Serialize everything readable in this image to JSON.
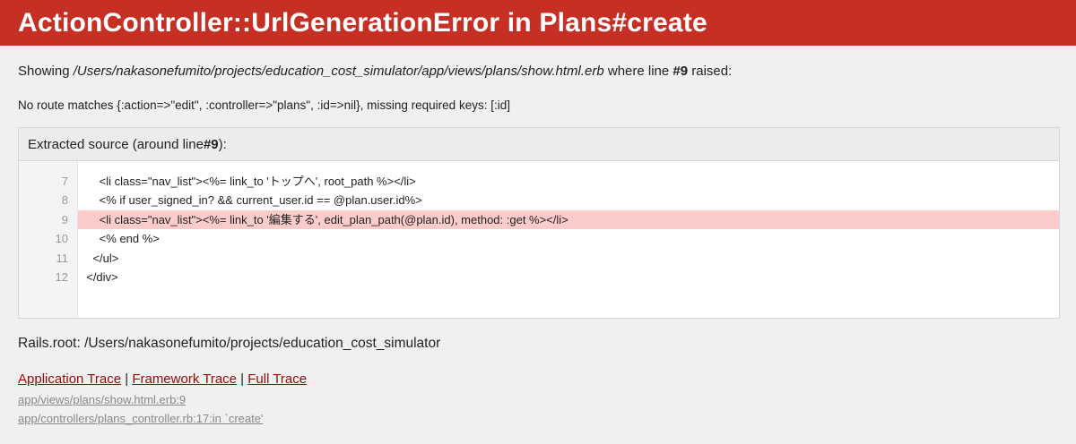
{
  "header": {
    "title": "ActionController::UrlGenerationError in Plans#create"
  },
  "showing": {
    "prefix": "Showing ",
    "path": "/Users/nakasonefumito/projects/education_cost_simulator/app/views/plans/show.html.erb",
    "middle": " where line ",
    "line": "#9",
    "suffix": " raised:"
  },
  "message": "No route matches {:action=>\"edit\", :controller=>\"plans\", :id=>nil}, missing required keys: [:id]",
  "source": {
    "header_prefix": "Extracted source (around line ",
    "header_line": "#9",
    "header_suffix": "):",
    "lines": [
      {
        "num": "7",
        "code": "      <li class=\"nav_list\"><%= link_to 'トップへ', root_path %></li>"
      },
      {
        "num": "8",
        "code": "      <% if user_signed_in? && current_user.id == @plan.user.id%>"
      },
      {
        "num": "9",
        "code": "      <li class=\"nav_list\"><%= link_to '編集する', edit_plan_path(@plan.id), method: :get %></li>"
      },
      {
        "num": "10",
        "code": "      <% end %>"
      },
      {
        "num": "11",
        "code": "    </ul>"
      },
      {
        "num": "12",
        "code": "  </div>"
      }
    ]
  },
  "rails_root": "Rails.root: /Users/nakasonefumito/projects/education_cost_simulator",
  "traces": {
    "application": "Application Trace",
    "framework": "Framework Trace",
    "full": "Full Trace",
    "separator": " | "
  },
  "trace_lines": [
    "app/views/plans/show.html.erb:9",
    "app/controllers/plans_controller.rb:17:in `create'"
  ]
}
